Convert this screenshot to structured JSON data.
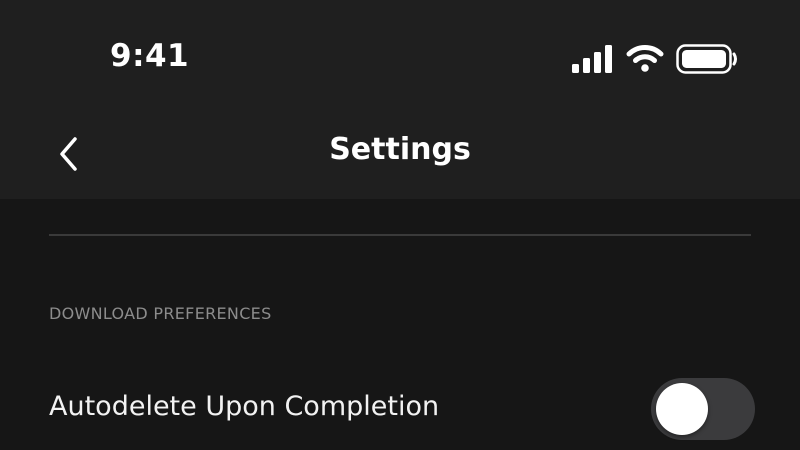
{
  "status_bar": {
    "time": "9:41",
    "icons": [
      "cellular-signal-icon",
      "wifi-icon",
      "battery-icon"
    ]
  },
  "nav_bar": {
    "back_icon": "chevron-left-icon",
    "title": "Settings"
  },
  "sections": [
    {
      "header": "DOWNLOAD PREFERENCES",
      "rows": [
        {
          "label": "Autodelete Upon Completion",
          "toggle_on": false
        }
      ]
    }
  ],
  "colors": {
    "background": "#161616",
    "nav_background": "#1f1f1f",
    "divider": "#3a3a3a",
    "section_header": "#8c8c8c",
    "toggle_off_track": "#3b3b3d",
    "toggle_knob": "#ffffff"
  }
}
